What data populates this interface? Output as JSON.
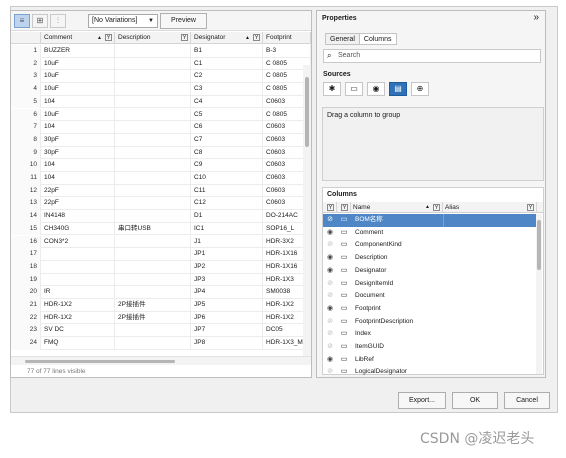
{
  "toolbar": {
    "variation_select": "[No Variations]",
    "preview_label": "Preview"
  },
  "grid": {
    "columns": [
      "",
      "Comment",
      "Description",
      "Designator",
      "Footprint"
    ],
    "rows": [
      [
        "1",
        "BUZZER",
        "",
        "B1",
        "B-3"
      ],
      [
        "2",
        "10uF",
        "",
        "C1",
        "C 0805"
      ],
      [
        "3",
        "10uF",
        "",
        "C2",
        "C 0805"
      ],
      [
        "4",
        "10uF",
        "",
        "C3",
        "C 0805"
      ],
      [
        "5",
        "104",
        "",
        "C4",
        "C0603"
      ],
      [
        "6",
        "10uF",
        "",
        "C5",
        "C 0805"
      ],
      [
        "7",
        "104",
        "",
        "C6",
        "C0603"
      ],
      [
        "8",
        "30pF",
        "",
        "C7",
        "C0603"
      ],
      [
        "9",
        "30pF",
        "",
        "C8",
        "C0603"
      ],
      [
        "10",
        "104",
        "",
        "C9",
        "C0603"
      ],
      [
        "11",
        "104",
        "",
        "C10",
        "C0603"
      ],
      [
        "12",
        "22pF",
        "",
        "C11",
        "C0603"
      ],
      [
        "13",
        "22pF",
        "",
        "C12",
        "C0603"
      ],
      [
        "14",
        "IN4148",
        "",
        "D1",
        "DO-214AC"
      ],
      [
        "15",
        "CH340G",
        "串口转USB",
        "IC1",
        "SOP16_L"
      ],
      [
        "16",
        "CON3*2",
        "",
        "J1",
        "HDR-3X2"
      ],
      [
        "17",
        "",
        "",
        "JP1",
        "HDR-1X16"
      ],
      [
        "18",
        "",
        "",
        "JP2",
        "HDR-1X16"
      ],
      [
        "19",
        "",
        "",
        "JP3",
        "HDR-1X3"
      ],
      [
        "20",
        "IR",
        "",
        "JP4",
        "SM0038"
      ],
      [
        "21",
        "HDR-1X2",
        "2P接插件",
        "JP5",
        "HDR-1X2"
      ],
      [
        "22",
        "HDR-1X2",
        "2P接插件",
        "JP6",
        "HDR-1X2"
      ],
      [
        "23",
        "SV DC",
        "",
        "JP7",
        "DC05"
      ],
      [
        "24",
        "FMQ",
        "",
        "JP8",
        "HDR-1X3_M"
      ]
    ],
    "status": "77 of 77 lines visible"
  },
  "properties": {
    "title": "Properties",
    "collapse_icon": "»",
    "tabs": [
      "General",
      "Columns"
    ],
    "search_placeholder": "Search",
    "sources_label": "Sources",
    "drag_label": "Drag a column to group",
    "columns_label": "Columns",
    "columns_header": {
      "name": "Name",
      "alias": "Alias"
    },
    "columns_list": [
      {
        "name": "BOM名称",
        "visible": false,
        "selected": true
      },
      {
        "name": "Comment",
        "visible": true,
        "selected": false
      },
      {
        "name": "ComponentKind",
        "visible": false,
        "selected": false
      },
      {
        "name": "Description",
        "visible": true,
        "selected": false
      },
      {
        "name": "Designator",
        "visible": true,
        "selected": false
      },
      {
        "name": "DesignItemId",
        "visible": false,
        "selected": false
      },
      {
        "name": "Document",
        "visible": false,
        "selected": false
      },
      {
        "name": "Footprint",
        "visible": true,
        "selected": false
      },
      {
        "name": "FootprintDescription",
        "visible": false,
        "selected": false
      },
      {
        "name": "Index",
        "visible": false,
        "selected": false
      },
      {
        "name": "ItemGUID",
        "visible": false,
        "selected": false
      },
      {
        "name": "LibRef",
        "visible": true,
        "selected": false
      },
      {
        "name": "LogicalDesignator",
        "visible": false,
        "selected": false
      }
    ]
  },
  "buttons": {
    "export": "Export...",
    "ok": "OK",
    "cancel": "Cancel"
  },
  "watermark": "CSDN @凌迟老头"
}
